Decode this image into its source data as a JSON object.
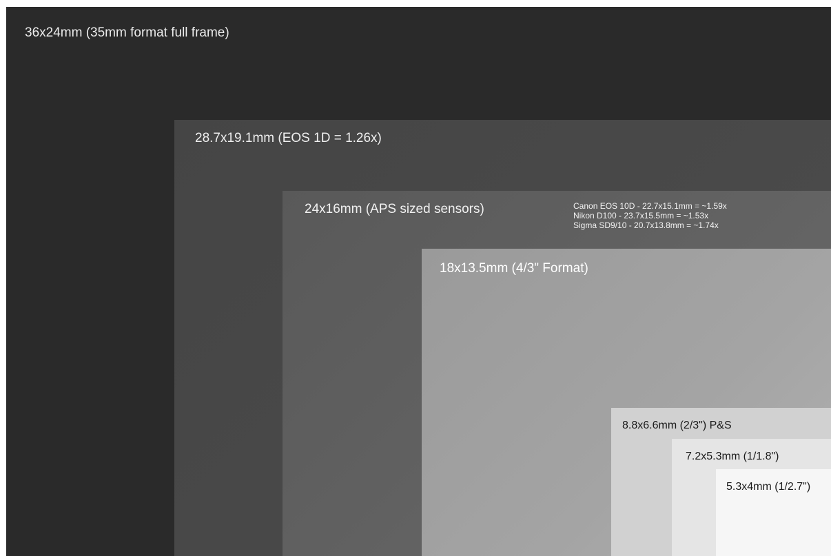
{
  "sensors": {
    "full_frame": {
      "label": "36x24mm (35mm format full frame)",
      "color": "#2a2a2a"
    },
    "eos_1d": {
      "label": "28.7x19.1mm (EOS 1D = 1.26x)",
      "color": "#494949"
    },
    "aps": {
      "label": "24x16mm (APS sized sensors)",
      "color": "#616161",
      "notes": [
        "Canon EOS 10D - 22.7x15.1mm = ~1.59x",
        "Nikon D100 - 23.7x15.5mm = ~1.53x",
        "Sigma SD9/10 - 20.7x13.8mm = ~1.74x"
      ]
    },
    "four_thirds": {
      "label": "18x13.5mm (4/3\" Format)",
      "color": "#a0a0a0"
    },
    "two_thirds": {
      "label": "8.8x6.6mm (2/3\") P&S",
      "color": "#d1d1d1"
    },
    "one_over_1_8": {
      "label": "7.2x5.3mm (1/1.8\")",
      "color": "#e5e5e5"
    },
    "one_over_2_7": {
      "label": "5.3x4mm (1/2.7\")",
      "color": "#f6f6f6"
    }
  }
}
